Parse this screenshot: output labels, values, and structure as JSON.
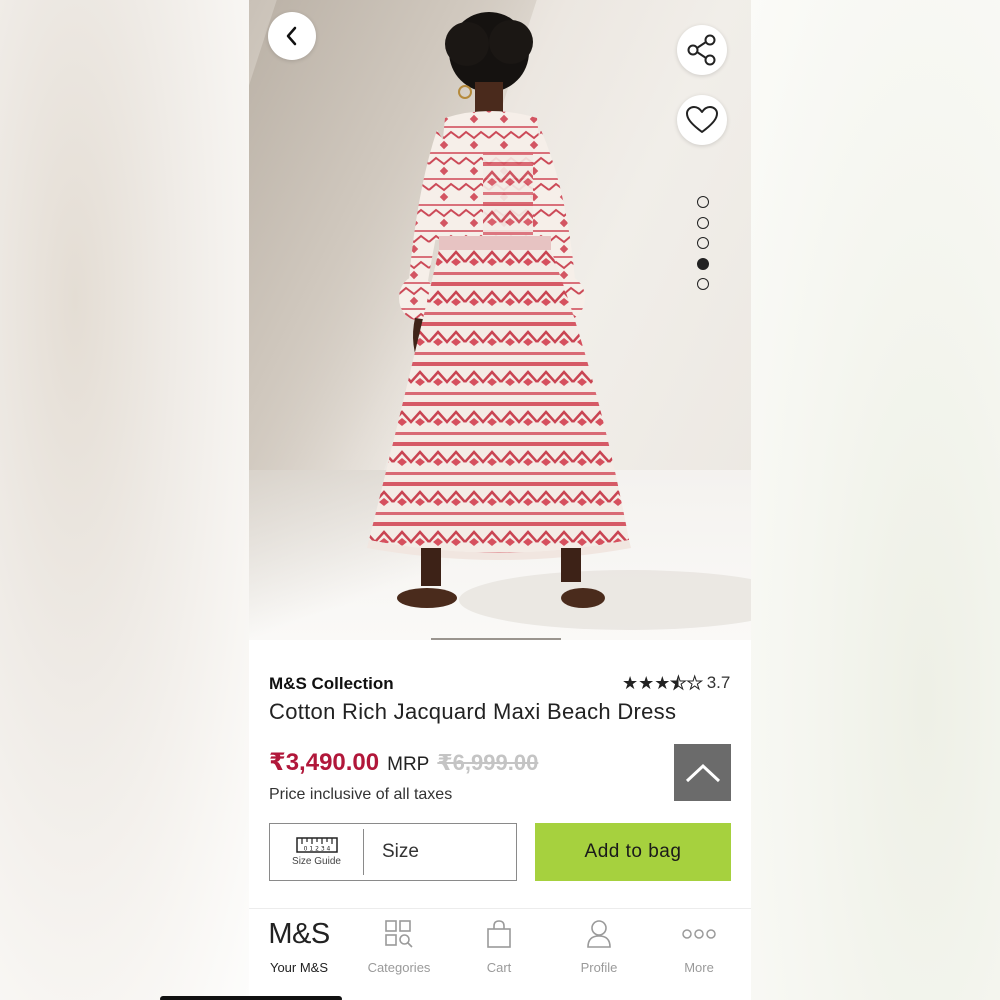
{
  "product": {
    "brand": "M&S Collection",
    "title": "Cotton Rich Jacquard Maxi Beach Dress",
    "rating": 3.7,
    "rating_text": "3.7",
    "price": "₹3,490.00",
    "mrp_label": "MRP",
    "mrp": "₹6,999.00",
    "tax_note": "Price inclusive of all taxes"
  },
  "gallery": {
    "image_count": 5,
    "active_index": 3
  },
  "actions": {
    "size_guide_label": "Size Guide",
    "size_guide_ruler": "0 1 2 3 4",
    "size_label": "Size",
    "add_to_bag": "Add to bag"
  },
  "nav": {
    "items": [
      {
        "label": "Your M&S",
        "icon": "ms-logo-icon",
        "logo_text": "M&S",
        "active": true
      },
      {
        "label": "Categories",
        "icon": "categories-icon",
        "active": false
      },
      {
        "label": "Cart",
        "icon": "cart-icon",
        "active": false
      },
      {
        "label": "Profile",
        "icon": "profile-icon",
        "active": false
      },
      {
        "label": "More",
        "icon": "more-icon",
        "active": false
      }
    ]
  },
  "colors": {
    "price": "#b1173a",
    "add_to_bag": "#a6d13e",
    "scroll_top": "#6b6b6b"
  }
}
